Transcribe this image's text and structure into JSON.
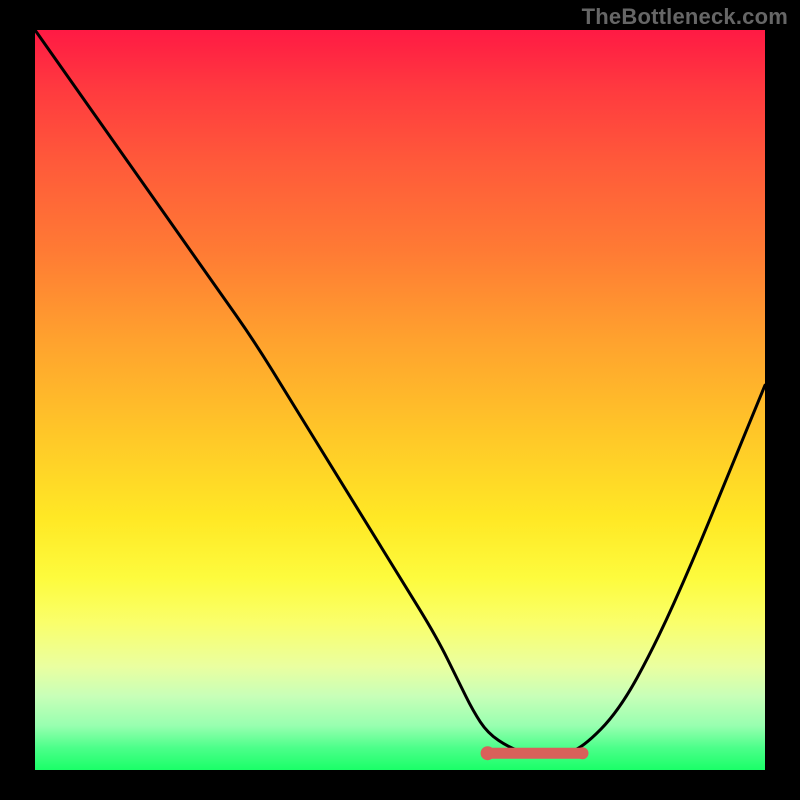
{
  "watermark": "TheBottleneck.com",
  "chart_data": {
    "type": "line",
    "title": "",
    "xlabel": "",
    "ylabel": "",
    "xlim": [
      0,
      100
    ],
    "ylim": [
      0,
      100
    ],
    "series": [
      {
        "name": "bottleneck-curve",
        "x": [
          0,
          5,
          10,
          15,
          20,
          25,
          30,
          35,
          40,
          45,
          50,
          55,
          58,
          60,
          62,
          65,
          68,
          70,
          72,
          75,
          80,
          85,
          90,
          95,
          100
        ],
        "y": [
          100,
          93,
          86,
          79,
          72,
          65,
          58,
          50,
          42,
          34,
          26,
          18,
          12,
          8,
          5,
          3,
          2,
          2,
          2,
          3,
          8,
          17,
          28,
          40,
          52
        ]
      }
    ],
    "trough": {
      "x_start": 62,
      "x_end": 75,
      "y": 2
    },
    "gradient_colors": {
      "top": "#ff1a44",
      "mid_high": "#ff7b34",
      "mid": "#ffe825",
      "mid_low": "#eaffa0",
      "bottom": "#1aff68"
    }
  }
}
